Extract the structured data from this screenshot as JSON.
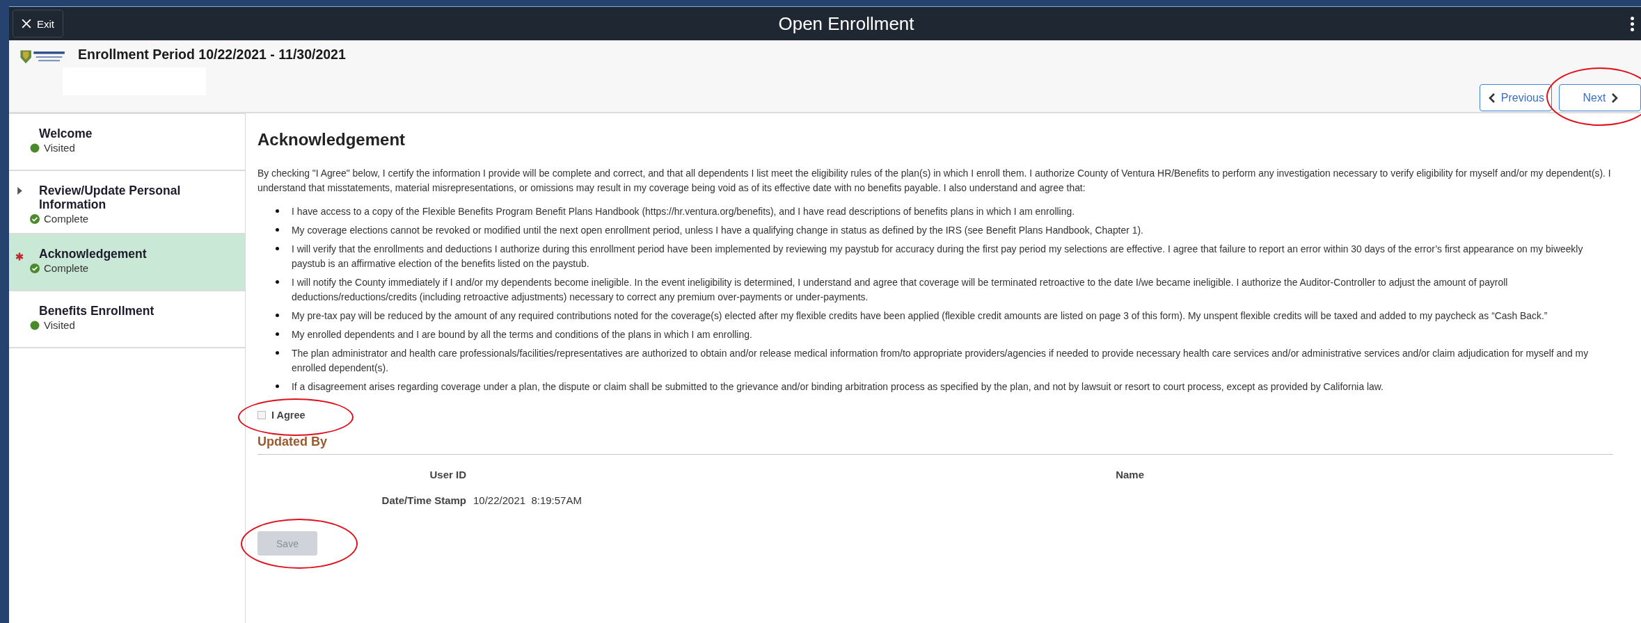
{
  "window": {
    "title": "Open Enrollment",
    "exit_button": "Exit"
  },
  "header": {
    "heading": "Enrollment Period 10/22/2021 - 11/30/2021"
  },
  "nav_buttons": [
    {
      "label": "Previous",
      "kind": "previous",
      "circled": false
    },
    {
      "label": "Next",
      "kind": "next",
      "circled": true
    }
  ],
  "steps": [
    {
      "title": "Welcome",
      "status": "Visited",
      "kind": "visited",
      "selected": false,
      "required": false,
      "expandable": false
    },
    {
      "title": "Review/Update Personal Information",
      "status": "Complete",
      "kind": "complete",
      "selected": false,
      "required": false,
      "expandable": true
    },
    {
      "title": "Acknowledgement",
      "status": "Complete",
      "kind": "complete",
      "selected": true,
      "required": true,
      "expandable": false
    },
    {
      "title": "Benefits Enrollment",
      "status": "Visited",
      "kind": "visited",
      "selected": false,
      "required": false,
      "expandable": false
    }
  ],
  "page": {
    "title": "Acknowledgement",
    "intro": "By checking \"I Agree\" below, I certify the information I provide will be complete and correct, and that all dependents I list meet the eligibility rules of the plan(s) in which I enroll them. I authorize County of Ventura HR/Benefits to perform any investigation necessary to verify eligibility for myself and/or my dependent(s). I understand that misstatements, material misrepresentations, or omissions may result in my coverage being void as of its effective date with no benefits payable.  I also understand and agree that:",
    "bullets": [
      "I have access to a copy of the Flexible Benefits Program Benefit Plans Handbook (https://hr.ventura.org/benefits), and I have read descriptions of benefits plans in which I am enrolling.",
      "My coverage elections cannot be revoked or modified until the next open enrollment period, unless I have a qualifying change in status as defined by the IRS (see Benefit Plans Handbook, Chapter 1).",
      "I will verify that the enrollments and deductions I authorize during this enrollment period have been implemented by reviewing my paystub for accuracy during the first pay period my selections are effective. I agree that failure to report an error within 30 days of the error’s first appearance on my biweekly paystub is an affirmative election of the benefits listed on the paystub.",
      "I will notify the County immediately if I and/or my dependents become ineligible. In the event ineligibility is determined, I understand and agree that coverage will be terminated retroactive to the date I/we became ineligible. I authorize the Auditor-Controller to adjust the amount of payroll deductions/reductions/credits (including retroactive adjustments) necessary to correct any premium over-payments or under-payments.",
      "My pre-tax pay will be reduced by the amount of any required contributions noted for the coverage(s) elected after my flexible credits have been applied (flexible credit amounts are listed on page 3 of this form). My unspent flexible credits will be taxed and added to my paycheck as “Cash Back.”",
      "My enrolled dependents and I are bound by all the terms and conditions of the plans in which I am enrolling.",
      "The plan administrator and health care professionals/facilities/representatives are authorized to obtain and/or release medical information from/to appropriate providers/agencies if needed to provide necessary health care services and/or administrative services and/or claim adjudication for myself and my enrolled dependent(s).",
      "If a disagreement arises regarding coverage under a plan, the dispute or claim shall be submitted to the grievance and/or binding arbitration process as specified by the plan, and not by lawsuit or resort to court process, except as provided by California law."
    ],
    "agree": {
      "label": "I Agree",
      "checked": false,
      "circled": true
    },
    "updated_by": {
      "heading": "Updated By",
      "rows": [
        {
          "fields": [
            {
              "label": "User ID"
            },
            {
              "label": "Name"
            }
          ]
        },
        {
          "fields": [
            {
              "label": "Date/Time Stamp",
              "value": "10/22/2021  8:19:57AM"
            }
          ]
        }
      ]
    },
    "save_button": {
      "label": "Save",
      "disabled": true,
      "circled": true
    }
  }
}
